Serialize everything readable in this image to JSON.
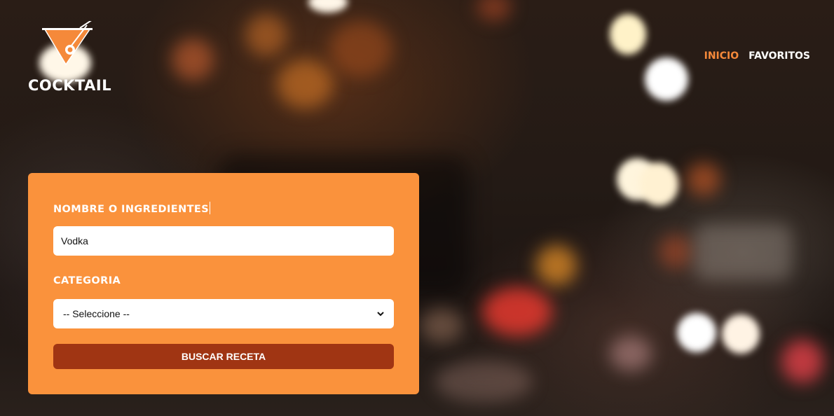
{
  "header": {
    "logo_text": "COCKTAIL",
    "nav": [
      {
        "label": "INICIO",
        "active": true
      },
      {
        "label": "FAVORITOS",
        "active": false
      }
    ]
  },
  "search_form": {
    "name_label": "NOMBRE O INGREDIENTES",
    "name_value": "Vodka",
    "category_label": "CATEGORIA",
    "category_selected": "-- Seleccione --",
    "submit_label": "BUSCAR RECETA"
  },
  "colors": {
    "accent": "#fa923c",
    "nav_active": "#f5893a",
    "button": "#a03513",
    "text_light": "#ffffff"
  },
  "icons": {
    "logo": "cocktail-glass-icon",
    "select_arrow": "chevron-down-icon"
  }
}
